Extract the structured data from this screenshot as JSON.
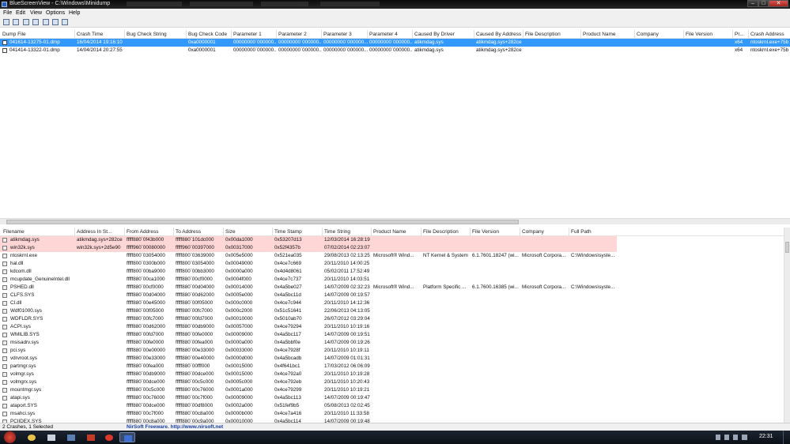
{
  "window": {
    "title": "BlueScreenView  -  C:\\Windows\\Minidump",
    "controls": {
      "minimize": "–",
      "maximize": "□",
      "close": "✕"
    }
  },
  "menu": [
    "File",
    "Edit",
    "View",
    "Options",
    "Help"
  ],
  "toolbar": [
    "properties-icon",
    "save-icon",
    "html-report-icon",
    "copy-icon",
    "options-icon",
    "find-icon",
    "refresh-icon",
    "about-icon"
  ],
  "top_table": {
    "columns": [
      "Dump File",
      "Crash Time",
      "Bug Check String",
      "Bug Check Code",
      "Parameter 1",
      "Parameter 2",
      "Parameter 3",
      "Parameter 4",
      "Caused By Driver",
      "Caused By Address",
      "File Description",
      "Product Name",
      "Company",
      "File Version",
      "Pr...",
      "Crash Address"
    ],
    "rows": [
      [
        "041614-13275-01.dmp",
        "16/04/2014 19:16:10",
        "",
        "0xa0000001",
        "00000000`000000...",
        "00000000`000000...",
        "00000000`000000...",
        "00000000`000000...",
        "atikmdag.sys",
        "atikmdag.sys+282ce",
        "",
        "",
        "",
        "",
        "x64",
        "ntoskrnl.exe+75bc0"
      ],
      [
        "041414-13322-01.dmp",
        "14/04/2014 20:27:55",
        "",
        "0xa0000001",
        "00000000`000000...",
        "00000000`000000...",
        "00000000`000000...",
        "00000000`000000...",
        "atikmdag.sys",
        "atikmdag.sys+282ce",
        "",
        "",
        "",
        "",
        "x64",
        "ntoskrnl.exe+75bc0"
      ]
    ],
    "selected_index": 0
  },
  "bottom_table": {
    "columns": [
      "Filename",
      "Address In St...",
      "From Address",
      "To Address",
      "Size",
      "Time Stamp",
      "Time String",
      "Product Name",
      "File Description",
      "File Version",
      "Company",
      "Full Path"
    ],
    "rows": [
      [
        "atikmdag.sys",
        "atikmdag.sys+282ce",
        "fffff880`0f43b000",
        "fffff880`101dc000",
        "0x00da1000",
        "0x53207d13",
        "12/03/2014 16:28:19",
        "",
        "",
        "",
        "",
        ""
      ],
      [
        "win32k.sys",
        "win32k.sys+2d5e90",
        "fffff960`00080000",
        "fffff960`00397000",
        "0x00317000",
        "0x52f4357b",
        "07/02/2014 02:23:07",
        "",
        "",
        "",
        "",
        ""
      ],
      [
        "ntoskrnl.exe",
        "",
        "fffff800`03054000",
        "fffff800`03639000",
        "0x005e5000",
        "0x521ea035",
        "29/08/2013 02:13:25",
        "Microsoft® Wind...",
        "NT Kernel & System",
        "6.1.7601.18247 (wi...",
        "Microsoft Corpora...",
        "C:\\Windows\\syste..."
      ],
      [
        "hal.dll",
        "",
        "fffff800`0300b000",
        "fffff800`03054000",
        "0x00049000",
        "0x4ce7c669",
        "20/11/2010 14:00:25",
        "",
        "",
        "",
        "",
        ""
      ],
      [
        "kdcom.dll",
        "",
        "fffff800`00ba9000",
        "fffff800`00bb3000",
        "0x0000a000",
        "0x4d4d8061",
        "05/02/2011 17:52:49",
        "",
        "",
        "",
        "",
        ""
      ],
      [
        "mcupdate_GenuineIntel.dll",
        "",
        "fffff880`00ca1000",
        "fffff880`00cf0000",
        "0x0004f000",
        "0x4ce7c737",
        "20/11/2010 14:03:51",
        "",
        "",
        "",
        "",
        ""
      ],
      [
        "PSHED.dll",
        "",
        "fffff880`00cf0000",
        "fffff880`00d04000",
        "0x00014000",
        "0x4a5be027",
        "14/07/2009 02:32:23",
        "Microsoft® Wind...",
        "Platform Specific ...",
        "6.1.7600.16385 (wi...",
        "Microsoft Corpora...",
        "C:\\Windows\\syste..."
      ],
      [
        "CLFS.SYS",
        "",
        "fffff880`00d04000",
        "fffff880`00d62000",
        "0x0005e000",
        "0x4a5bc11d",
        "14/07/2009 00:19:57",
        "",
        "",
        "",
        "",
        ""
      ],
      [
        "CI.dll",
        "",
        "fffff880`00e45000",
        "fffff880`00f05000",
        "0x000c0000",
        "0x4ce7c944",
        "20/11/2010 14:12:36",
        "",
        "",
        "",
        "",
        ""
      ],
      [
        "Wdf01000.sys",
        "",
        "fffff880`00f05000",
        "fffff880`00fc7000",
        "0x000c2000",
        "0x51c51641",
        "22/06/2013 04:13:05",
        "",
        "",
        "",
        "",
        ""
      ],
      [
        "WDFLDR.SYS",
        "",
        "fffff880`00fc7000",
        "fffff880`00fd7000",
        "0x00010000",
        "0x5010ab70",
        "26/07/2012 03:29:04",
        "",
        "",
        "",
        "",
        ""
      ],
      [
        "ACPI.sys",
        "",
        "fffff880`00d62000",
        "fffff880`00db9000",
        "0x00057000",
        "0x4ce79294",
        "20/11/2010 10:19:16",
        "",
        "",
        "",
        "",
        ""
      ],
      [
        "WMILIB.SYS",
        "",
        "fffff880`00fd7000",
        "fffff880`00fe0000",
        "0x00009000",
        "0x4a5bc117",
        "14/07/2009 00:19:51",
        "",
        "",
        "",
        "",
        ""
      ],
      [
        "msisadrv.sys",
        "",
        "fffff880`00fe0000",
        "fffff880`00fea000",
        "0x0000a000",
        "0x4a5bbf0e",
        "14/07/2009 00:19:26",
        "",
        "",
        "",
        "",
        ""
      ],
      [
        "pci.sys",
        "",
        "fffff880`00e00000",
        "fffff880`00e33000",
        "0x00033000",
        "0x4ce7928f",
        "20/11/2010 10:19:11",
        "",
        "",
        "",
        "",
        ""
      ],
      [
        "vdrvroot.sys",
        "",
        "fffff880`00e33000",
        "fffff880`00e40000",
        "0x0000d000",
        "0x4a5bcadb",
        "14/07/2009 01:01:31",
        "",
        "",
        "",
        "",
        ""
      ],
      [
        "partmgr.sys",
        "",
        "fffff880`00fea000",
        "fffff880`00fff000",
        "0x00015000",
        "0x4f641bc1",
        "17/03/2012 06:06:09",
        "",
        "",
        "",
        "",
        ""
      ],
      [
        "volmgr.sys",
        "",
        "fffff880`00db9000",
        "fffff880`00dce000",
        "0x00015000",
        "0x4ce792a0",
        "20/11/2010 10:19:28",
        "",
        "",
        "",
        "",
        ""
      ],
      [
        "volmgrx.sys",
        "",
        "fffff880`00dce000",
        "fffff880`00c5c000",
        "0x0005c000",
        "0x4ce792eb",
        "20/11/2010 10:20:43",
        "",
        "",
        "",
        "",
        ""
      ],
      [
        "mountmgr.sys",
        "",
        "fffff880`00c5c000",
        "fffff880`00c76000",
        "0x0001a000",
        "0x4ce79299",
        "20/11/2010 10:19:21",
        "",
        "",
        "",
        "",
        ""
      ],
      [
        "atapi.sys",
        "",
        "fffff880`00c76000",
        "fffff880`00c7f000",
        "0x00009000",
        "0x4a5bc113",
        "14/07/2009 00:19:47",
        "",
        "",
        "",
        "",
        ""
      ],
      [
        "ataport.SYS",
        "",
        "fffff880`00dce000",
        "fffff880`00df8000",
        "0x0002a000",
        "0x51fef9b5",
        "05/08/2013 02:02:45",
        "",
        "",
        "",
        "",
        ""
      ],
      [
        "msahci.sys",
        "",
        "fffff880`00c7f000",
        "fffff880`00c8a000",
        "0x0000b000",
        "0x4ce7a416",
        "20/11/2010 11:33:58",
        "",
        "",
        "",
        "",
        ""
      ],
      [
        "PCIIDEX.SYS",
        "",
        "fffff880`00c8a000",
        "fffff880`00c9a000",
        "0x00010000",
        "0x4a5bc114",
        "14/07/2009 00:19:48",
        "",
        "",
        "",
        "",
        ""
      ]
    ],
    "highlighted_indices": [
      0,
      1
    ]
  },
  "status": {
    "summary": "2 Crashes, 1 Selected",
    "credit": "NirSoft Freeware.  http://www.nirsoft.net",
    "credit_color": "#1a3fa6"
  },
  "taskbar": {
    "items": [
      "start-orb-icon",
      "chrome-icon",
      "app-icon",
      "network-icon",
      "game-icon",
      "media-icon",
      "bluescreenview-icon"
    ],
    "clock": "22:31"
  },
  "colors": {
    "selected_row": "#3399ff",
    "highlight_row": "#ffd6d6"
  }
}
